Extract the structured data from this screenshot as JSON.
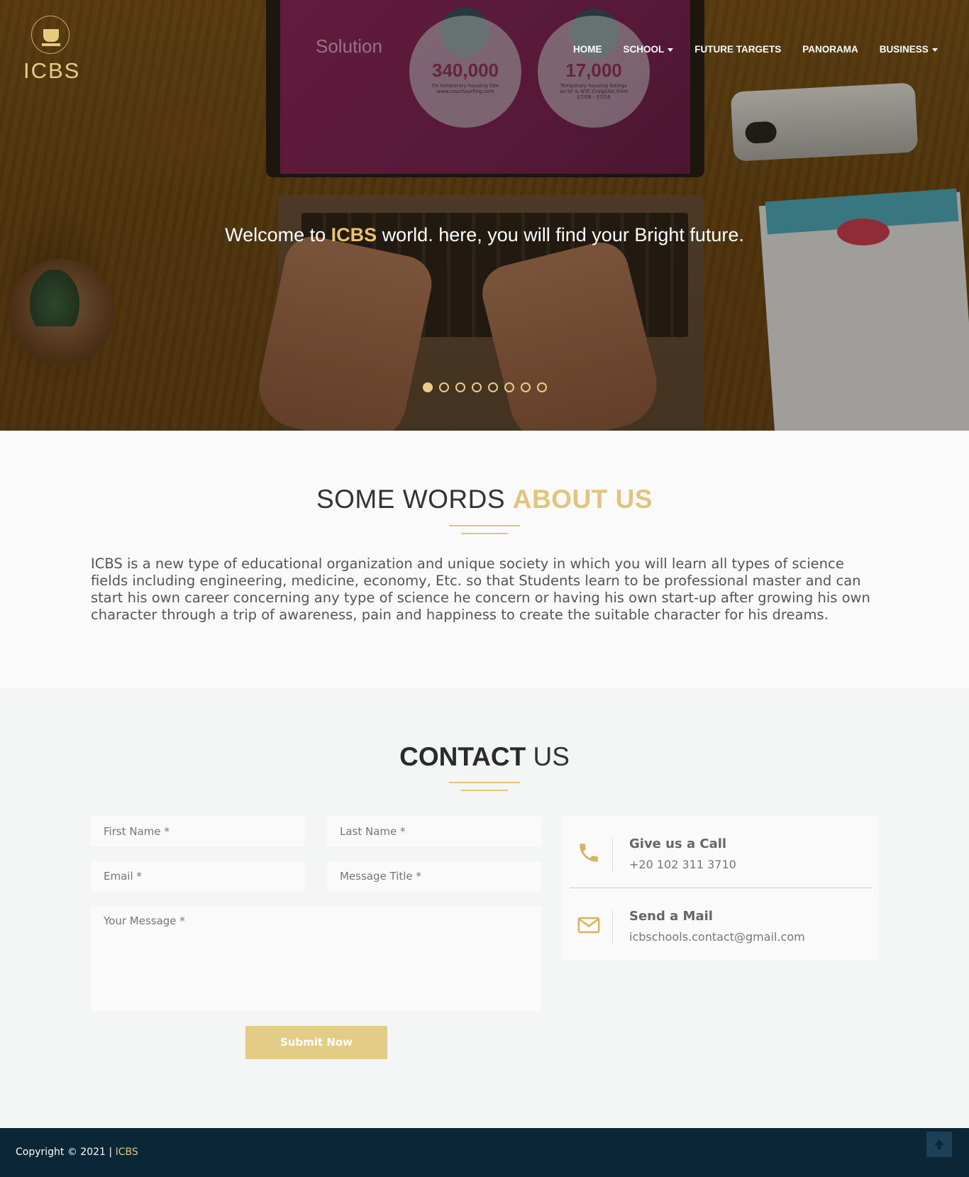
{
  "brand": {
    "name": "ICBS"
  },
  "nav": {
    "items": [
      {
        "label": "HOME",
        "dropdown": false
      },
      {
        "label": "SCHOOL",
        "dropdown": true
      },
      {
        "label": "FUTURE TARGETS",
        "dropdown": false
      },
      {
        "label": "PANORAMA",
        "dropdown": false
      },
      {
        "label": "BUSINESS",
        "dropdown": true
      }
    ]
  },
  "hero": {
    "caption_pre": "Welcome to ",
    "caption_highlight": "ICBS",
    "caption_post": " world. here, you will find your Bright future.",
    "slide_count": 8,
    "active_slide": 0,
    "screen": {
      "title": "Solution",
      "stat1": "340,000",
      "stat1_sub": "On temporary housing Site www.couchsurfing.com",
      "stat2": "17,000",
      "stat2_sub": "Temporary housing listings on SF & NYC Craigslist from 07/09 - 07/16"
    }
  },
  "about": {
    "title_pre": "SOME WORDS ",
    "title_highlight": "ABOUT US",
    "body": "ICBS is a new type of educational organization and unique society in which you will learn all types of science fields including engineering, medicine, economy, Etc. so that Students learn to be professional master and can start his own career concerning any type of science he concern or having his own start-up after growing his own character through a trip of awareness, pain and happiness to create the suitable character for his dreams."
  },
  "contact": {
    "title_bold": "CONTACT",
    "title_light": " US",
    "form": {
      "first_name_placeholder": "First Name *",
      "last_name_placeholder": "Last Name *",
      "email_placeholder": "Email *",
      "message_title_placeholder": "Message Title *",
      "message_placeholder": "Your Message *",
      "submit_label": "Submit Now"
    },
    "info": {
      "call_title": "Give us a Call",
      "call_value": "+20 102 311 3710",
      "mail_title": "Send a Mail",
      "mail_value": "icbschools.contact@gmail.com"
    }
  },
  "footer": {
    "copyright": "Copyright © 2021 | ",
    "brand": "ICBS"
  },
  "colors": {
    "accent": "#e2c47c",
    "footer_bg": "#0b2637"
  },
  "icons": [
    "phone-icon",
    "envelope-icon",
    "arrow-up-icon",
    "chevron-down-icon"
  ]
}
